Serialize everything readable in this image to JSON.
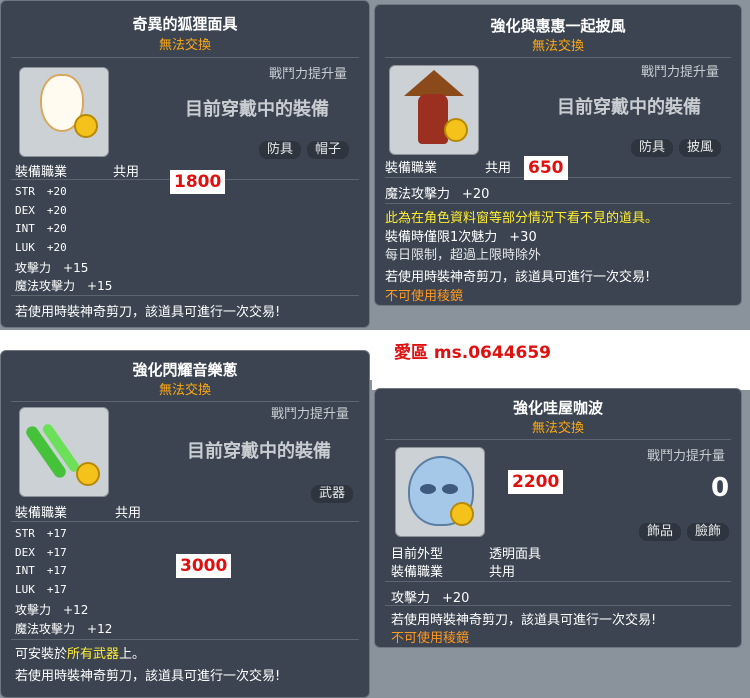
{
  "watermark": "愛區 ms.0644659",
  "items": [
    {
      "title": "奇異的狐狸面具",
      "trade": "無法交換",
      "power_label": "戰鬥力提升量",
      "equipped_text": "目前穿戴中的裝備",
      "tags": [
        "防具",
        "帽子"
      ],
      "job_label": "裝備職業",
      "job_value": "共用",
      "price": "1800",
      "stats": [
        {
          "label": "STR",
          "value": "+20"
        },
        {
          "label": "DEX",
          "value": "+20"
        },
        {
          "label": "INT",
          "value": "+20"
        },
        {
          "label": "LUK",
          "value": "+20"
        },
        {
          "label": "攻擊力",
          "value": "+15"
        },
        {
          "label": "魔法攻擊力",
          "value": "+15"
        }
      ],
      "note": "若使用時裝神奇剪刀，該道具可進行一次交易!"
    },
    {
      "title": "強化與惠惠一起披風",
      "trade": "無法交換",
      "power_label": "戰鬥力提升量",
      "equipped_text": "目前穿戴中的裝備",
      "tags": [
        "防具",
        "披風"
      ],
      "job_label": "裝備職業",
      "job_value": "共用",
      "price": "650",
      "stats": [
        {
          "label": "魔法攻擊力",
          "value": "+20"
        }
      ],
      "yellow_note": "此為在角色資料窗等部分情況下看不見的道具。",
      "charm_label": "裝備時僅限1次魅力",
      "charm_value": "+30",
      "daily_limit": "每日限制，超過上限時除外",
      "note": "若使用時裝神奇剪刀，該道具可進行一次交易!",
      "orange_note": "不可使用稜鏡"
    },
    {
      "title": "強化閃耀音樂蔥",
      "trade": "無法交換",
      "power_label": "戰鬥力提升量",
      "equipped_text": "目前穿戴中的裝備",
      "tags": [
        "武器"
      ],
      "job_label": "裝備職業",
      "job_value": "共用",
      "price": "3000",
      "stats": [
        {
          "label": "STR",
          "value": "+17"
        },
        {
          "label": "DEX",
          "value": "+17"
        },
        {
          "label": "INT",
          "value": "+17"
        },
        {
          "label": "LUK",
          "value": "+17"
        },
        {
          "label": "攻擊力",
          "value": "+12"
        },
        {
          "label": "魔法攻擊力",
          "value": "+12"
        }
      ],
      "install_prefix": "可安裝於",
      "install_highlight": "所有武器",
      "install_suffix": "上。",
      "note": "若使用時裝神奇剪刀，該道具可進行一次交易!"
    },
    {
      "title": "強化哇屋咖波",
      "trade": "無法交換",
      "power_label": "戰鬥力提升量",
      "power_value": "0",
      "tags": [
        "飾品",
        "臉飾"
      ],
      "price": "2200",
      "appearance_label": "目前外型",
      "appearance_value": "透明面具",
      "job_label": "裝備職業",
      "job_value": "共用",
      "stats": [
        {
          "label": "攻擊力",
          "value": "+20"
        }
      ],
      "note": "若使用時裝神奇剪刀，該道具可進行一次交易!",
      "orange_note": "不可使用稜鏡"
    }
  ],
  "colors": {
    "panel_bg": "#3b4450",
    "trade": "#ffaa11",
    "yellow": "#ffee33",
    "price": "#e01010"
  }
}
